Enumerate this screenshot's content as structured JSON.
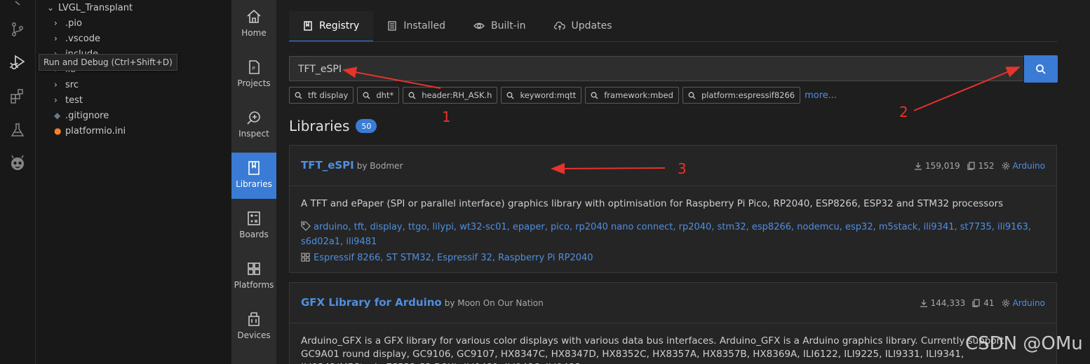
{
  "explorer": {
    "root": "LVGL_Transplant",
    "items": [
      ".pio",
      ".vscode",
      "include",
      "lib",
      "src",
      "test",
      ".gitignore",
      "platformio.ini"
    ]
  },
  "tooltip": "Run and Debug (Ctrl+Shift+D)",
  "activity_icons": [
    "source-control-icon",
    "run-debug-icon",
    "extensions-icon",
    "testing-icon",
    "platformio-icon"
  ],
  "nav": {
    "items": [
      {
        "label": "Home",
        "icon": "home-icon"
      },
      {
        "label": "Projects",
        "icon": "projects-icon"
      },
      {
        "label": "Inspect",
        "icon": "inspect-icon"
      },
      {
        "label": "Libraries",
        "icon": "libraries-icon",
        "active": true
      },
      {
        "label": "Boards",
        "icon": "boards-icon"
      },
      {
        "label": "Platforms",
        "icon": "platforms-icon"
      },
      {
        "label": "Devices",
        "icon": "devices-icon"
      }
    ]
  },
  "tabs": [
    {
      "label": "Registry",
      "icon": "book-icon"
    },
    {
      "label": "Installed",
      "icon": "list-icon"
    },
    {
      "label": "Built-in",
      "icon": "eye-icon"
    },
    {
      "label": "Updates",
      "icon": "cloud-icon"
    }
  ],
  "search": {
    "value": "TFT_eSPI"
  },
  "chips": [
    "tft display",
    "dht*",
    "header:RH_ASK.h",
    "keyword:mqtt",
    "framework:mbed",
    "platform:espressif8266"
  ],
  "more_label": "more...",
  "libraries": {
    "heading": "Libraries",
    "count": "50",
    "items": [
      {
        "name": "TFT_eSPI",
        "author": "by Bodmer",
        "downloads": "159,019",
        "examples": "152",
        "framework": "Arduino",
        "description": "A TFT and ePaper (SPI or parallel interface) graphics library with optimisation for Raspberry Pi Pico, RP2040, ESP8266, ESP32 and STM32 processors",
        "keywords": "arduino, tft, display, ttgo, lilypi, wt32-sc01, epaper, pico, rp2040 nano connect, rp2040, stm32, esp8266, nodemcu, esp32, m5stack, ili9341, st7735, ili9163, s6d02a1, ili9481",
        "platforms": "Espressif 8266, ST STM32, Espressif 32, Raspberry Pi RP2040"
      },
      {
        "name": "GFX Library for Arduino",
        "author": "by Moon On Our Nation",
        "downloads": "144,333",
        "examples": "41",
        "framework": "Arduino",
        "description": "Arduino_GFX is a GFX library for various color displays with various data bus interfaces. Arduino_GFX is a Arduino graphics library. Currently support GC9A01 round display, GC9106, GC9107, HX8347C, HX8347D, HX8352C, HX8357A, HX8357B, HX8369A, ILI6122, ILI9225, ILI9331, ILI9341, ILI9342(M5Stack, ESP32-S3-BOX), ILI9481, ILI9486, ILI9488,"
      }
    ]
  },
  "annotations": [
    "1",
    "2",
    "3"
  ],
  "annotation_color": "#e8332a",
  "accent_color": "#3a7bd5",
  "watermark": "CSDN @OMu"
}
